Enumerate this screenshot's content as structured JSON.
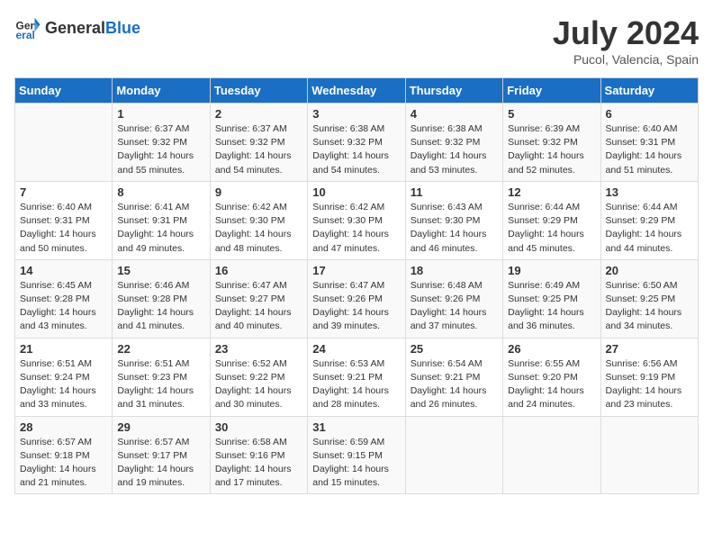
{
  "header": {
    "logo_general": "General",
    "logo_blue": "Blue",
    "title": "July 2024",
    "subtitle": "Pucol, Valencia, Spain"
  },
  "weekdays": [
    "Sunday",
    "Monday",
    "Tuesday",
    "Wednesday",
    "Thursday",
    "Friday",
    "Saturday"
  ],
  "rows": [
    [
      {
        "day": "",
        "info": ""
      },
      {
        "day": "1",
        "info": "Sunrise: 6:37 AM\nSunset: 9:32 PM\nDaylight: 14 hours\nand 55 minutes."
      },
      {
        "day": "2",
        "info": "Sunrise: 6:37 AM\nSunset: 9:32 PM\nDaylight: 14 hours\nand 54 minutes."
      },
      {
        "day": "3",
        "info": "Sunrise: 6:38 AM\nSunset: 9:32 PM\nDaylight: 14 hours\nand 54 minutes."
      },
      {
        "day": "4",
        "info": "Sunrise: 6:38 AM\nSunset: 9:32 PM\nDaylight: 14 hours\nand 53 minutes."
      },
      {
        "day": "5",
        "info": "Sunrise: 6:39 AM\nSunset: 9:32 PM\nDaylight: 14 hours\nand 52 minutes."
      },
      {
        "day": "6",
        "info": "Sunrise: 6:40 AM\nSunset: 9:31 PM\nDaylight: 14 hours\nand 51 minutes."
      }
    ],
    [
      {
        "day": "7",
        "info": "Sunrise: 6:40 AM\nSunset: 9:31 PM\nDaylight: 14 hours\nand 50 minutes."
      },
      {
        "day": "8",
        "info": "Sunrise: 6:41 AM\nSunset: 9:31 PM\nDaylight: 14 hours\nand 49 minutes."
      },
      {
        "day": "9",
        "info": "Sunrise: 6:42 AM\nSunset: 9:30 PM\nDaylight: 14 hours\nand 48 minutes."
      },
      {
        "day": "10",
        "info": "Sunrise: 6:42 AM\nSunset: 9:30 PM\nDaylight: 14 hours\nand 47 minutes."
      },
      {
        "day": "11",
        "info": "Sunrise: 6:43 AM\nSunset: 9:30 PM\nDaylight: 14 hours\nand 46 minutes."
      },
      {
        "day": "12",
        "info": "Sunrise: 6:44 AM\nSunset: 9:29 PM\nDaylight: 14 hours\nand 45 minutes."
      },
      {
        "day": "13",
        "info": "Sunrise: 6:44 AM\nSunset: 9:29 PM\nDaylight: 14 hours\nand 44 minutes."
      }
    ],
    [
      {
        "day": "14",
        "info": "Sunrise: 6:45 AM\nSunset: 9:28 PM\nDaylight: 14 hours\nand 43 minutes."
      },
      {
        "day": "15",
        "info": "Sunrise: 6:46 AM\nSunset: 9:28 PM\nDaylight: 14 hours\nand 41 minutes."
      },
      {
        "day": "16",
        "info": "Sunrise: 6:47 AM\nSunset: 9:27 PM\nDaylight: 14 hours\nand 40 minutes."
      },
      {
        "day": "17",
        "info": "Sunrise: 6:47 AM\nSunset: 9:26 PM\nDaylight: 14 hours\nand 39 minutes."
      },
      {
        "day": "18",
        "info": "Sunrise: 6:48 AM\nSunset: 9:26 PM\nDaylight: 14 hours\nand 37 minutes."
      },
      {
        "day": "19",
        "info": "Sunrise: 6:49 AM\nSunset: 9:25 PM\nDaylight: 14 hours\nand 36 minutes."
      },
      {
        "day": "20",
        "info": "Sunrise: 6:50 AM\nSunset: 9:25 PM\nDaylight: 14 hours\nand 34 minutes."
      }
    ],
    [
      {
        "day": "21",
        "info": "Sunrise: 6:51 AM\nSunset: 9:24 PM\nDaylight: 14 hours\nand 33 minutes."
      },
      {
        "day": "22",
        "info": "Sunrise: 6:51 AM\nSunset: 9:23 PM\nDaylight: 14 hours\nand 31 minutes."
      },
      {
        "day": "23",
        "info": "Sunrise: 6:52 AM\nSunset: 9:22 PM\nDaylight: 14 hours\nand 30 minutes."
      },
      {
        "day": "24",
        "info": "Sunrise: 6:53 AM\nSunset: 9:21 PM\nDaylight: 14 hours\nand 28 minutes."
      },
      {
        "day": "25",
        "info": "Sunrise: 6:54 AM\nSunset: 9:21 PM\nDaylight: 14 hours\nand 26 minutes."
      },
      {
        "day": "26",
        "info": "Sunrise: 6:55 AM\nSunset: 9:20 PM\nDaylight: 14 hours\nand 24 minutes."
      },
      {
        "day": "27",
        "info": "Sunrise: 6:56 AM\nSunset: 9:19 PM\nDaylight: 14 hours\nand 23 minutes."
      }
    ],
    [
      {
        "day": "28",
        "info": "Sunrise: 6:57 AM\nSunset: 9:18 PM\nDaylight: 14 hours\nand 21 minutes."
      },
      {
        "day": "29",
        "info": "Sunrise: 6:57 AM\nSunset: 9:17 PM\nDaylight: 14 hours\nand 19 minutes."
      },
      {
        "day": "30",
        "info": "Sunrise: 6:58 AM\nSunset: 9:16 PM\nDaylight: 14 hours\nand 17 minutes."
      },
      {
        "day": "31",
        "info": "Sunrise: 6:59 AM\nSunset: 9:15 PM\nDaylight: 14 hours\nand 15 minutes."
      },
      {
        "day": "",
        "info": ""
      },
      {
        "day": "",
        "info": ""
      },
      {
        "day": "",
        "info": ""
      }
    ]
  ]
}
